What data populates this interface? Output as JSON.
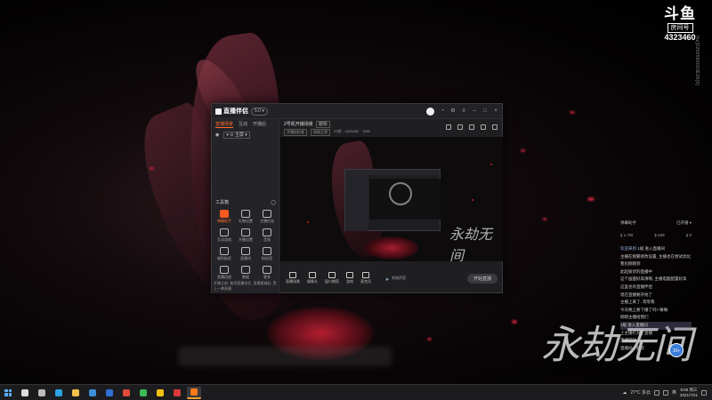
{
  "room_badge": {
    "logo": "斗鱼",
    "label": "房间号",
    "number": "4323460"
  },
  "vertical_code": "[hz]0206590003E95[0]",
  "app": {
    "name": "直播伴侣",
    "version_badge": "5.0 ▾",
    "left_tabs": [
      "直播场景",
      "互动",
      "开播后"
    ],
    "scene_label": "▾ ⊙ 主屏 ▾",
    "tools_title": "工具箱",
    "tools": [
      {
        "label": "弹幕助手",
        "hot": true
      },
      {
        "label": "礼物设置",
        "hot": false
      },
      {
        "label": "主播任务",
        "hot": false
      },
      {
        "label": "互动游戏",
        "hot": false
      },
      {
        "label": "开播设置",
        "hot": false
      },
      {
        "label": "音效",
        "hot": false
      },
      {
        "label": "福利抽奖",
        "hot": false
      },
      {
        "label": "直播间",
        "hot": false
      },
      {
        "label": "粉丝团",
        "hot": false
      },
      {
        "label": "直播回放",
        "hot": false
      },
      {
        "label": "数据",
        "hot": false
      },
      {
        "label": "更多",
        "hot": false
      }
    ],
    "footer_text": "开播之前: 使用直播伴侣, 直播更精彩, 黑上一拳直播",
    "stream_title": "2号机开播场景",
    "stream_edit": "编辑",
    "stream_meta": [
      "开播前检查",
      "网络正常",
      "20帧",
      "4323460",
      "1080"
    ],
    "bottom_tools": [
      "直播场景",
      "摄像头",
      "窗口捕获",
      "游戏",
      "麦克风"
    ],
    "volume_label": "系统声音",
    "start_live_label": "开始直播"
  },
  "chat": {
    "header_left": "弹幕助手",
    "header_right": "已开播 ▾",
    "stats": [
      "1.7W",
      "629",
      "0"
    ],
    "messages": [
      {
        "user": "欢迎来到",
        "text": " 1级 进入直播间"
      },
      {
        "user": "",
        "text": "主播在频繁修改设置, 主播也在尝试优化"
      },
      {
        "user": "",
        "text": "  我也刚刚到"
      },
      {
        "user": "",
        "text": "  此起彼伏的直播中"
      },
      {
        "user": "",
        "text": "这个画面好高清啊, 主播电脑配置好高"
      },
      {
        "user": "",
        "text": "这里也有直播伴侣"
      },
      {
        "user": "",
        "text": "现在直播要开始了"
      },
      {
        "user": "",
        "text": "  主播上来了, 等等我"
      },
      {
        "user": "",
        "text": "  今天晚上要下播了吗? 嘛嘛"
      },
      {
        "user": "",
        "text": "  刚刚主播给我们"
      },
      {
        "user": "",
        "text": "  1级 进入直播间"
      },
      {
        "user": "",
        "text": "  上主播打开了直播"
      },
      {
        "user": "",
        "text": "  直播回放"
      },
      {
        "user": "",
        "text": "  直播间一起玩"
      }
    ],
    "logo_text": "10+"
  },
  "taskbar": {
    "apps": [
      {
        "name": "search",
        "color": "#dddddd"
      },
      {
        "name": "task-view",
        "color": "#bbbbbb"
      },
      {
        "name": "edge",
        "color": "#2aa3e0"
      },
      {
        "name": "explorer",
        "color": "#f2c14e"
      },
      {
        "name": "store",
        "color": "#3a8fd8"
      },
      {
        "name": "mail",
        "color": "#2f6fd6"
      },
      {
        "name": "chrome",
        "color": "#e04a3a"
      },
      {
        "name": "app-green",
        "color": "#3cba54"
      },
      {
        "name": "app-yellow",
        "color": "#f4c20d"
      },
      {
        "name": "app-red",
        "color": "#d83a3a"
      },
      {
        "name": "app-orange",
        "color": "#ff7a1a"
      }
    ],
    "weather": "27°C 多云",
    "lang": "英",
    "time": "8:55 周三",
    "date": "2021/7/21"
  }
}
